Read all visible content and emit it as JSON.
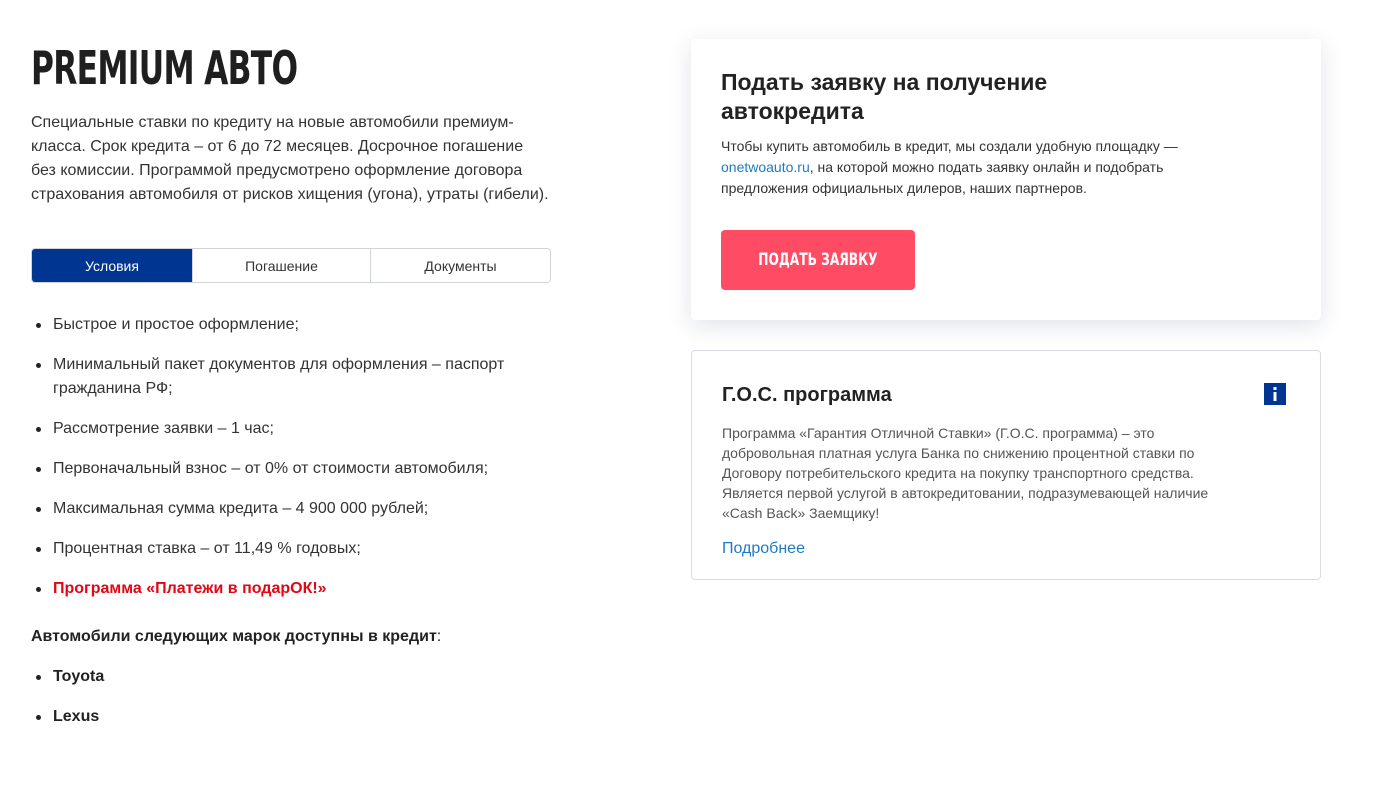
{
  "product": {
    "title": "PREMIUM АВТО",
    "intro": "Специальные ставки по кредиту на новые автомобили премиум-класса. Срок кредита – от 6 до 72 месяцев. Досрочное погашение без комиссии. Программой предусмотрено оформление договора страхования автомобиля от рисков хищения (угона), утраты (гибели)."
  },
  "tabs": [
    {
      "label": "Условия",
      "active": true
    },
    {
      "label": "Погашение",
      "active": false
    },
    {
      "label": "Документы",
      "active": false
    }
  ],
  "conditions": [
    "Быстрое и простое оформление;",
    "Минимальный пакет документов для оформления – паспорт гражданина РФ;",
    "Рассмотрение заявки – 1 час;",
    "Первоначальный взнос – от 0% от стоимости автомобиля;",
    "Максимальная сумма кредита – 4 900 000 рублей;",
    "Процентная ставка – от 11,49 % годовых;",
    "Программа «Платежи в подарОК!»"
  ],
  "brands": {
    "title": "Автомобили следующих марок доступны в кредит",
    "colon": ":",
    "items": [
      "Toyota",
      "Lexus"
    ]
  },
  "apply_card": {
    "title": "Подать заявку на получение автокредита",
    "text_before": "Чтобы купить автомобиль в кредит, мы создали удобную площадку — ",
    "link": "onetwoauto.ru",
    "text_after": ", на которой можно подать заявку онлайн и подобрать предложения официальных дилеров, наших партнеров.",
    "button": "ПОДАТЬ ЗАЯВКУ"
  },
  "gos_card": {
    "title": "Г.О.С. программа",
    "text": "Программа «Гарантия Отличной Ставки» (Г.О.С. программа) – это добровольная платная услуга Банка по снижению процентной ставки по Договору потребительского кредита на покупку транспортного средства. Является первой услугой в автокредитовании, подразумевающей наличие «Cash Back» Заемщику!",
    "more": "Подробнее"
  },
  "colors": {
    "tab_active": "#003591",
    "button": "#ff4b64",
    "link": "#1f7bc1",
    "promo": "#e30613"
  },
  "icons": {
    "info": "info-icon"
  }
}
